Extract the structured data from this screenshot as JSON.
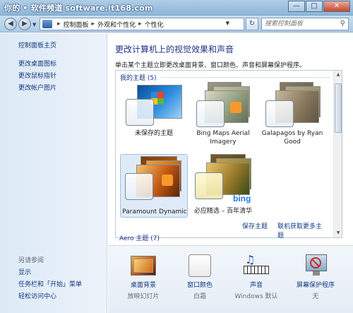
{
  "watermark": "你的 • 软件频道 software.it168.com",
  "window_buttons": {
    "minimize": "—",
    "maximize": "□",
    "close": "✕"
  },
  "address": {
    "crumbs": [
      "控制面板",
      "外观和个性化",
      "个性化"
    ],
    "separator": "▸"
  },
  "search": {
    "placeholder": "搜索控制面板"
  },
  "sidebar": {
    "links": [
      "控制面板主页",
      "更改桌面图标",
      "更改鼠标指针",
      "更改帐户图片"
    ],
    "see_also_title": "另请参阅",
    "see_also": [
      "显示",
      "任务栏和「开始」菜单",
      "轻松访问中心"
    ]
  },
  "main": {
    "title": "更改计算机上的视觉效果和声音",
    "description": "单击某个主题立即更改桌面背景、窗口颜色、声音和屏幕保护程序。",
    "my_themes_header": "我的主题 (5)",
    "aero_header": "Aero 主题 (7)",
    "themes": [
      {
        "label_1": "未保存的主题",
        "label_2": ""
      },
      {
        "label_1": "Bing Maps Aerial",
        "label_2": "Imagery"
      },
      {
        "label_1": "Galapagos by Ryan",
        "label_2": "Good"
      },
      {
        "label_1": "Paramount Dynamic",
        "label_2": ""
      },
      {
        "label_1": "必应精选 – 百年清华",
        "label_2": ""
      }
    ],
    "bing_logo_text": "bing",
    "save_theme": "保存主题",
    "get_more_themes": "联机获取更多主题"
  },
  "bottom": {
    "items": [
      {
        "title": "桌面背景",
        "sub": "放映幻灯片"
      },
      {
        "title": "窗口颜色",
        "sub": "白霜"
      },
      {
        "title": "声音",
        "sub": "Windows 默认"
      },
      {
        "title": "屏幕保护程序",
        "sub": "无"
      }
    ]
  },
  "colors": {
    "link": "#123a80",
    "heading": "#1e3287",
    "selection": "#dfeaf8"
  }
}
